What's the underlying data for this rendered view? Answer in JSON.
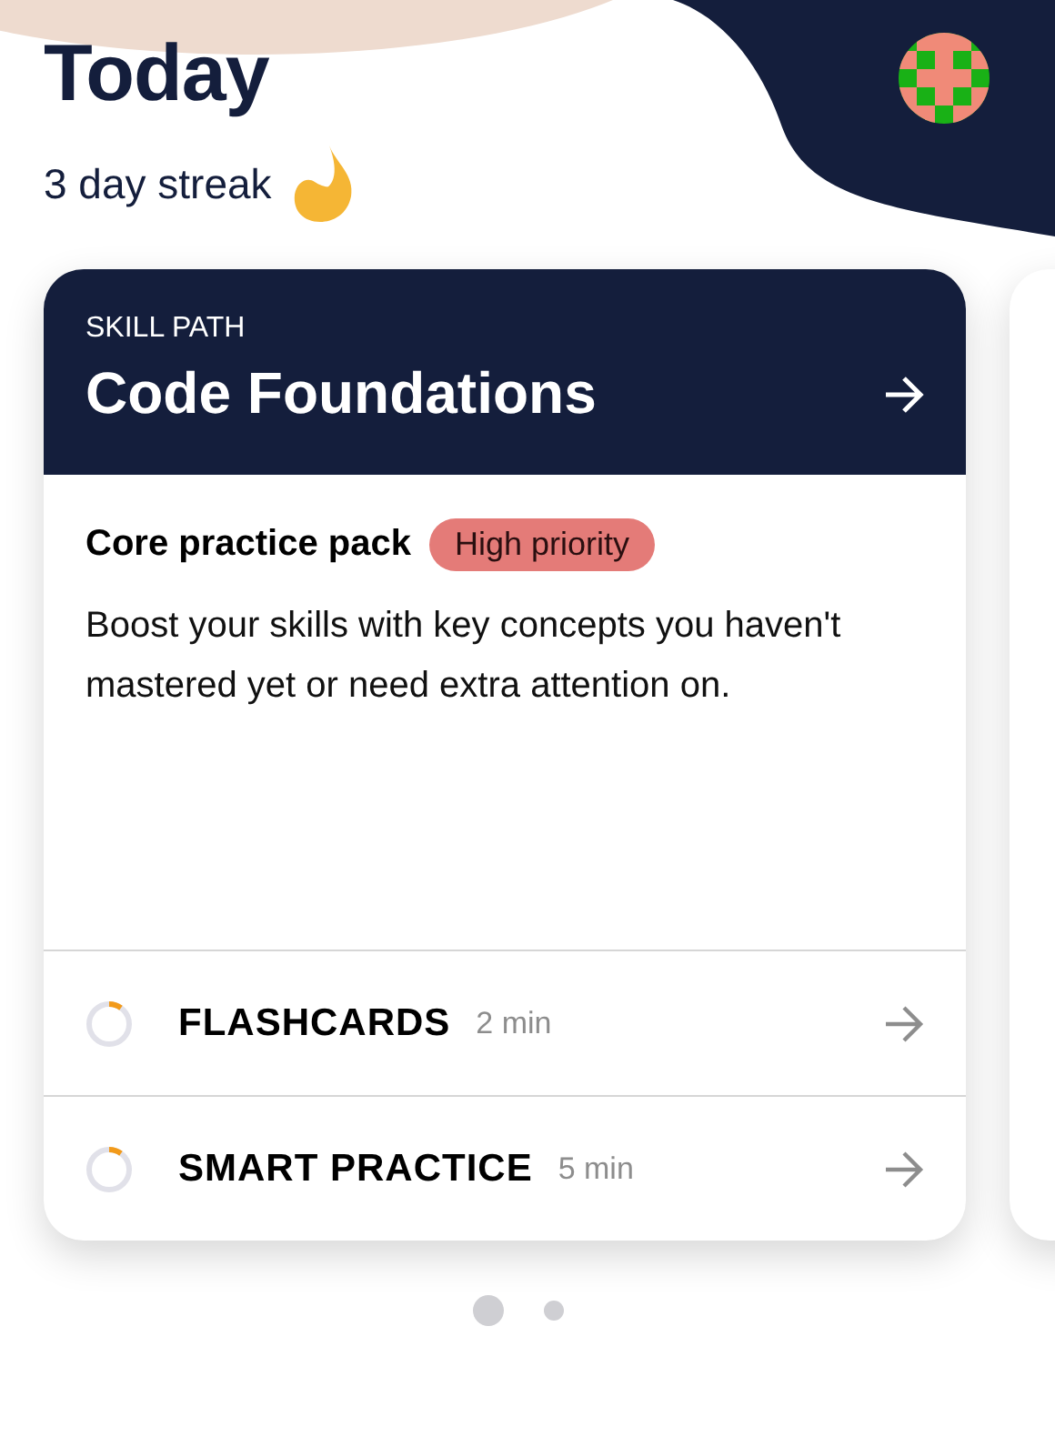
{
  "header": {
    "title": "Today",
    "streak": "3 day streak"
  },
  "card": {
    "eyebrow": "SKILL PATH",
    "title": "Code Foundations",
    "pack_title": "Core practice pack",
    "badge": "High priority",
    "description": "Boost your skills with key concepts you haven't mastered yet or need extra attention on.",
    "activities": [
      {
        "name": "FLASHCARDS",
        "duration": "2 min",
        "level": 0.1
      },
      {
        "name": "SMART PRACTICE",
        "duration": "5 min",
        "level": 0.1
      }
    ]
  },
  "pager": [
    {
      "selected": true
    },
    {
      "selected": false
    }
  ]
}
